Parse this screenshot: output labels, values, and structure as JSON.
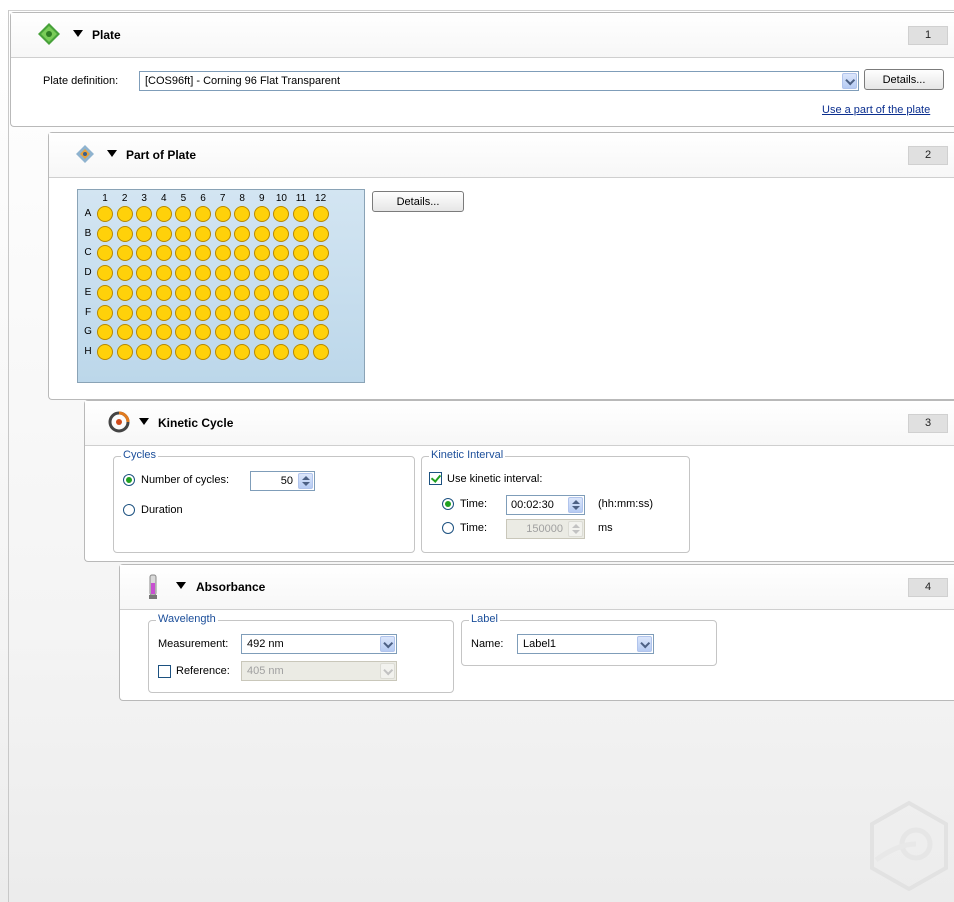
{
  "plate": {
    "number": "1",
    "title": "Plate",
    "definition_label": "Plate definition:",
    "definition_value": "[COS96ft] - Corning 96 Flat Transparent",
    "details_label": "Details...",
    "use_part_link": "Use a part of the plate"
  },
  "part_of_plate": {
    "number": "2",
    "title": "Part of Plate",
    "details_label": "Details...",
    "columns": [
      "1",
      "2",
      "3",
      "4",
      "5",
      "6",
      "7",
      "8",
      "9",
      "10",
      "11",
      "12"
    ],
    "rows": [
      "A",
      "B",
      "C",
      "D",
      "E",
      "F",
      "G",
      "H"
    ],
    "all_wells_selected": true
  },
  "kinetic_cycle": {
    "number": "3",
    "title": "Kinetic Cycle",
    "cycles": {
      "legend": "Cycles",
      "number_of_cycles_label": "Number of cycles:",
      "number_of_cycles_value": "50",
      "duration_label": "Duration",
      "selected": "number_of_cycles"
    },
    "interval": {
      "legend": "Kinetic Interval",
      "use_label": "Use kinetic interval:",
      "use_checked": true,
      "time_label": "Time:",
      "time_value": "00:02:30",
      "time_unit": "(hh:mm:ss)",
      "time2_label": "Time:",
      "time2_value": "150000",
      "time2_unit": "ms",
      "selected": "hhmmss"
    }
  },
  "absorbance": {
    "number": "4",
    "title": "Absorbance",
    "wavelength": {
      "legend": "Wavelength",
      "measurement_label": "Measurement:",
      "measurement_value": "492 nm",
      "reference_label": "Reference:",
      "reference_value": "405 nm",
      "reference_checked": false
    },
    "label": {
      "legend": "Label",
      "name_label": "Name:",
      "name_value": "Label1"
    }
  },
  "colors": {
    "well_fill": "#ffd10a",
    "plate_bg": "#c7dfef",
    "link": "#0b2f8f",
    "legend_text": "#1b4e9a",
    "radio_check": "#21a121"
  }
}
